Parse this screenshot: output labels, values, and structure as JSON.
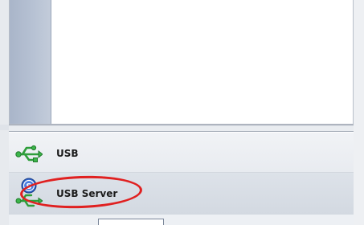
{
  "nav": {
    "items": [
      {
        "label": "USB",
        "icon": "usb-icon"
      },
      {
        "label": "USB Server",
        "icon": "usb-server-icon"
      }
    ],
    "selected": "USB Server"
  },
  "highlight": {
    "color": "#e02020",
    "target": "USB Server"
  },
  "colors": {
    "panel_border": "#b8bec8",
    "list_column": "#b6c1d3",
    "nav_background": "#edf0f4",
    "usb_icon": "#3aa83a",
    "server_badge": "#2f63c8"
  }
}
